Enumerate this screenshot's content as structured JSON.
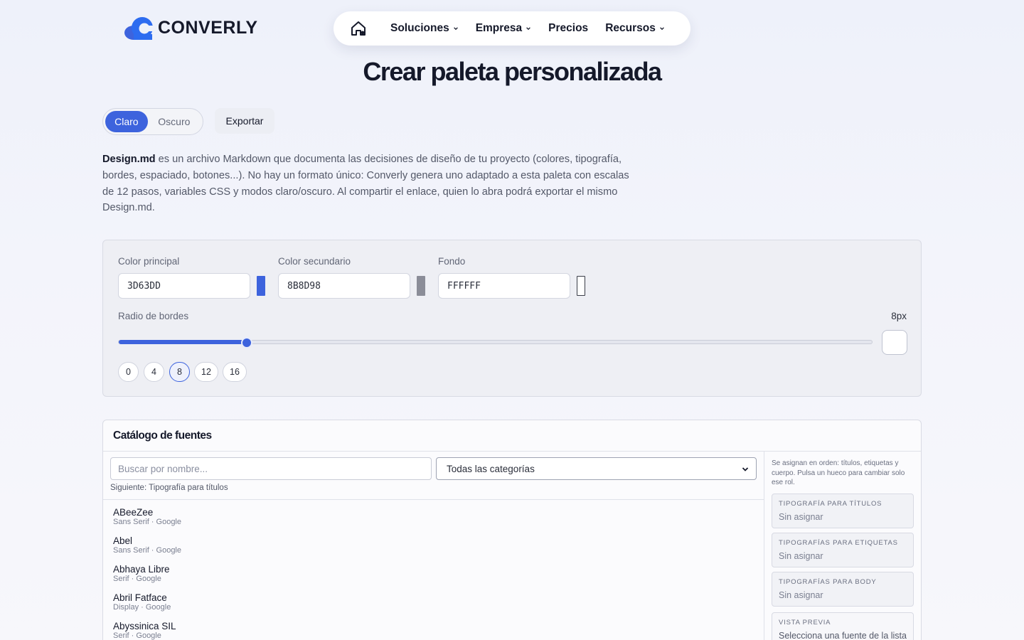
{
  "brand": {
    "name": "CONVERLY",
    "primary_color": "#3d63dd"
  },
  "nav": {
    "home_icon": "home-icon",
    "items": [
      {
        "label": "Soluciones",
        "has_dropdown": true
      },
      {
        "label": "Empresa",
        "has_dropdown": true
      },
      {
        "label": "Precios",
        "has_dropdown": false
      },
      {
        "label": "Recursos",
        "has_dropdown": true
      }
    ]
  },
  "page": {
    "title": "Crear paleta personalizada"
  },
  "mode_toggle": {
    "light": "Claro",
    "dark": "Oscuro",
    "selected": "Claro"
  },
  "export_label": "Exportar",
  "intro": {
    "bold": "Design.md",
    "text": " es un archivo Markdown que documenta las decisiones de diseño de tu proyecto (colores, tipografía, bordes, espaciado, botones...). No hay un formato único: Converly genera uno adaptado a esta paleta con escalas de 12 pasos, variables CSS y modos claro/oscuro. Al compartir el enlace, quien lo abra podrá exportar el mismo Design.md."
  },
  "colors": {
    "primary": {
      "label": "Color principal",
      "value": "3D63DD",
      "swatch": "#3d63dd"
    },
    "secondary": {
      "label": "Color secundario",
      "value": "8B8D98",
      "swatch": "#8b8d98"
    },
    "background": {
      "label": "Fondo",
      "value": "FFFFFF",
      "swatch": "#ffffff"
    }
  },
  "radius": {
    "label": "Radio de bordes",
    "value_label": "8px",
    "value": 8,
    "slider_fraction": 0.17,
    "presets": [
      "0",
      "4",
      "8",
      "12",
      "16"
    ],
    "selected_preset": "8"
  },
  "catalog": {
    "title": "Catálogo de fuentes",
    "search_placeholder": "Buscar por nombre...",
    "category_selected": "Todas las categorías",
    "next_label": "Siguiente: Tipografía para títulos",
    "fonts": [
      {
        "name": "ABeeZee",
        "meta": "Sans Serif · Google"
      },
      {
        "name": "Abel",
        "meta": "Sans Serif · Google"
      },
      {
        "name": "Abhaya Libre",
        "meta": "Serif · Google"
      },
      {
        "name": "Abril Fatface",
        "meta": "Display · Google"
      },
      {
        "name": "Abyssinica SIL",
        "meta": "Serif · Google"
      }
    ],
    "assign_note": "Se asignan en orden: títulos, etiquetas y cuerpo. Pulsa un hueco para cambiar solo ese rol.",
    "slots": [
      {
        "title": "TIPOGRAFÍA PARA TÍTULOS",
        "value": "Sin asignar"
      },
      {
        "title": "TIPOGRAFÍAS PARA ETIQUETAS",
        "value": "Sin asignar"
      },
      {
        "title": "TIPOGRAFÍAS PARA BODY",
        "value": "Sin asignar"
      },
      {
        "title": "VISTA PREVIA",
        "value": "Selecciona una fuente de la lista"
      }
    ]
  }
}
